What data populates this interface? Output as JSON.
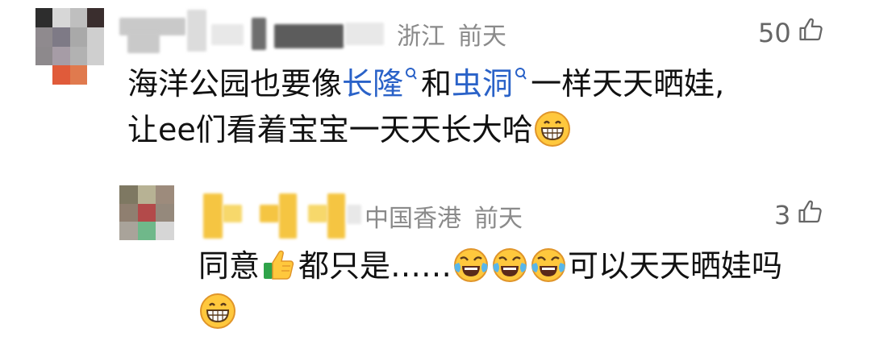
{
  "main_comment": {
    "location": "浙江",
    "time": "前天",
    "likes": "50",
    "segments": {
      "text1": "海洋公园也要像",
      "link1": "长隆",
      "text2": "和",
      "link2": "虫洞",
      "text3": "一样天天晒娃,",
      "text4": "让ee们看着宝宝一天天长大哈"
    },
    "emoji": "grinning-face-with-big-eyes"
  },
  "reply": {
    "location": "中国香港",
    "time": "前天",
    "likes": "3",
    "segments": {
      "text1": "同意",
      "text2": "都只是……",
      "text3": "可以天天晒娃吗"
    },
    "emojis": [
      "thumbs-up",
      "face-with-tears-of-joy",
      "face-with-tears-of-joy",
      "face-with-tears-of-joy",
      "grinning-face-with-big-eyes"
    ]
  },
  "colors": {
    "link": "#2a62c8",
    "meta": "#8a8a8a",
    "text": "#111111"
  }
}
